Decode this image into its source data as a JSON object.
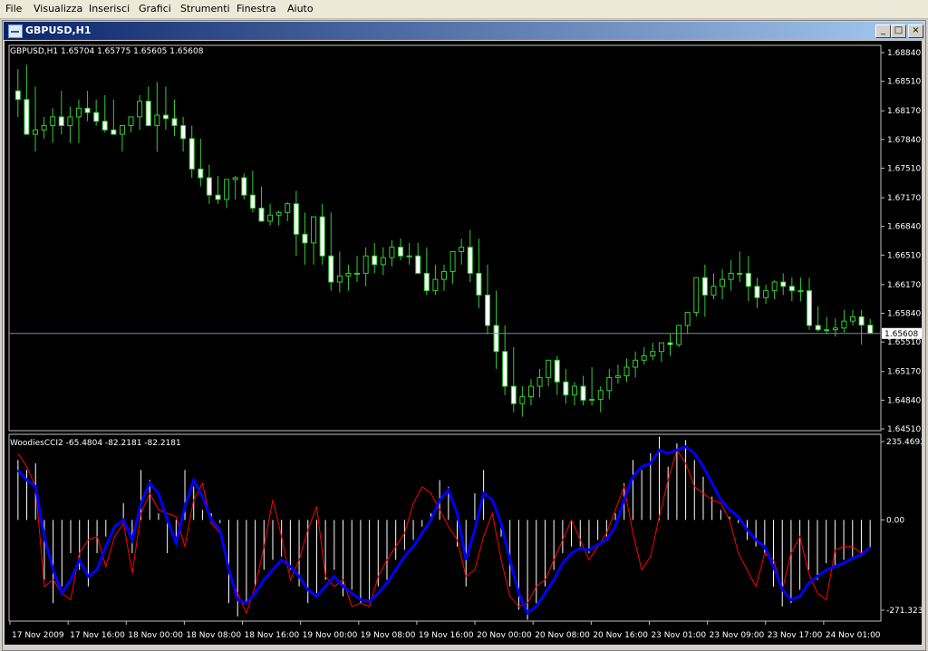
{
  "menu": [
    "File",
    "Visualizza",
    "Inserisci",
    "Grafici",
    "Strumenti",
    "Finestra",
    "Aiuto"
  ],
  "window": {
    "title": "GBPUSD,H1",
    "buttons": [
      "_",
      "□",
      "×"
    ]
  },
  "chart_data": {
    "type": "candlestick",
    "title": "GBPUSD,H1  1.65704 1.65775 1.65605 1.65608",
    "price_axis": [
      "1.68840",
      "1.68510",
      "1.68170",
      "1.67840",
      "1.67510",
      "1.67170",
      "1.66840",
      "1.66510",
      "1.66170",
      "1.65840",
      "1.65510",
      "1.65170",
      "1.64840",
      "1.64510"
    ],
    "current_price": "1.65608",
    "ohlc": {
      "open": [
        1.684,
        1.683,
        1.679,
        1.6795,
        1.68,
        1.681,
        1.68,
        1.681,
        1.682,
        1.6815,
        1.6805,
        1.6795,
        1.679,
        1.68,
        1.681,
        1.6828,
        1.68,
        1.6812,
        1.6808,
        1.68,
        1.6785,
        1.675,
        1.674,
        1.672,
        1.6715,
        1.6738,
        1.674,
        1.672,
        1.6705,
        1.669,
        1.6697,
        1.67,
        1.671,
        1.6675,
        1.6665,
        1.6695,
        1.665,
        1.662,
        1.6627,
        1.663,
        1.663,
        1.665,
        1.664,
        1.6648,
        1.666,
        1.665,
        1.665,
        1.663,
        1.661,
        1.6623,
        1.6632,
        1.6655,
        1.666,
        1.663,
        1.6605,
        1.657,
        1.654,
        1.65,
        1.648,
        1.6488,
        1.65,
        1.651,
        1.653,
        1.6505,
        1.649,
        1.65,
        1.6484,
        1.6485,
        1.6495,
        1.651,
        1.6512,
        1.6522,
        1.653,
        1.6535,
        1.654,
        1.655,
        1.6548,
        1.657,
        1.6585,
        1.6625,
        1.6605,
        1.6615,
        1.6623,
        1.663,
        1.663,
        1.6615,
        1.6602,
        1.661,
        1.662,
        1.6615,
        1.661,
        1.661,
        1.657,
        1.6565,
        1.6565,
        1.6567,
        1.6575,
        1.658,
        1.65704
      ],
      "high": [
        1.6865,
        1.687,
        1.6845,
        1.681,
        1.682,
        1.684,
        1.6822,
        1.683,
        1.684,
        1.683,
        1.6835,
        1.683,
        1.68,
        1.6808,
        1.6835,
        1.6845,
        1.685,
        1.6845,
        1.683,
        1.681,
        1.68,
        1.6785,
        1.6755,
        1.6742,
        1.672,
        1.6742,
        1.6745,
        1.6748,
        1.673,
        1.671,
        1.6702,
        1.6712,
        1.6725,
        1.67,
        1.668,
        1.671,
        1.67,
        1.6655,
        1.664,
        1.665,
        1.666,
        1.6665,
        1.666,
        1.6668,
        1.667,
        1.6665,
        1.6665,
        1.666,
        1.664,
        1.664,
        1.6645,
        1.667,
        1.668,
        1.667,
        1.664,
        1.661,
        1.657,
        1.6545,
        1.65,
        1.6508,
        1.652,
        1.653,
        1.6535,
        1.652,
        1.6505,
        1.6512,
        1.6522,
        1.65,
        1.652,
        1.6525,
        1.6532,
        1.654,
        1.6545,
        1.655,
        1.655,
        1.656,
        1.6565,
        1.6585,
        1.6625,
        1.664,
        1.663,
        1.6635,
        1.6645,
        1.6655,
        1.665,
        1.6625,
        1.6617,
        1.6622,
        1.663,
        1.6625,
        1.6625,
        1.6625,
        1.6592,
        1.658,
        1.6578,
        1.6588,
        1.6588,
        1.6588,
        1.65775
      ],
      "low": [
        1.681,
        1.679,
        1.677,
        1.6785,
        1.678,
        1.679,
        1.678,
        1.678,
        1.6805,
        1.68,
        1.6792,
        1.679,
        1.677,
        1.6792,
        1.6795,
        1.68,
        1.677,
        1.6795,
        1.6788,
        1.677,
        1.674,
        1.673,
        1.671,
        1.671,
        1.6705,
        1.6715,
        1.6715,
        1.67,
        1.669,
        1.6685,
        1.6685,
        1.669,
        1.665,
        1.664,
        1.664,
        1.664,
        1.661,
        1.6608,
        1.661,
        1.662,
        1.6615,
        1.663,
        1.6628,
        1.6638,
        1.6645,
        1.664,
        1.6635,
        1.6605,
        1.6605,
        1.661,
        1.6618,
        1.664,
        1.662,
        1.659,
        1.656,
        1.652,
        1.649,
        1.647,
        1.6465,
        1.6478,
        1.6487,
        1.65,
        1.649,
        1.648,
        1.6478,
        1.6478,
        1.6478,
        1.647,
        1.6485,
        1.6503,
        1.6505,
        1.651,
        1.6525,
        1.653,
        1.6528,
        1.6535,
        1.6545,
        1.656,
        1.658,
        1.658,
        1.66,
        1.66,
        1.661,
        1.662,
        1.6598,
        1.659,
        1.6595,
        1.66,
        1.6605,
        1.6598,
        1.6598,
        1.6565,
        1.6563,
        1.656,
        1.6557,
        1.6562,
        1.657,
        1.6548,
        1.65605
      ],
      "close": [
        1.683,
        1.679,
        1.6795,
        1.68,
        1.681,
        1.68,
        1.681,
        1.682,
        1.6815,
        1.6805,
        1.6795,
        1.679,
        1.68,
        1.681,
        1.6828,
        1.68,
        1.6812,
        1.6808,
        1.68,
        1.6785,
        1.675,
        1.674,
        1.672,
        1.6715,
        1.6738,
        1.674,
        1.672,
        1.6705,
        1.669,
        1.6697,
        1.67,
        1.671,
        1.6675,
        1.6665,
        1.6695,
        1.665,
        1.662,
        1.6627,
        1.663,
        1.663,
        1.665,
        1.664,
        1.6648,
        1.666,
        1.665,
        1.665,
        1.663,
        1.661,
        1.6623,
        1.6632,
        1.6655,
        1.666,
        1.663,
        1.6605,
        1.657,
        1.654,
        1.65,
        1.648,
        1.6488,
        1.65,
        1.651,
        1.653,
        1.6505,
        1.649,
        1.65,
        1.6484,
        1.6485,
        1.6495,
        1.651,
        1.6512,
        1.6522,
        1.653,
        1.6535,
        1.654,
        1.655,
        1.6548,
        1.657,
        1.6585,
        1.6625,
        1.6605,
        1.6615,
        1.6623,
        1.663,
        1.663,
        1.6615,
        1.6602,
        1.661,
        1.662,
        1.6615,
        1.661,
        1.661,
        1.657,
        1.6565,
        1.6565,
        1.6567,
        1.6575,
        1.658,
        1.65704,
        1.65608
      ]
    },
    "time_axis": [
      "17 Nov 2009",
      "17 Nov 16:00",
      "18 Nov 00:00",
      "18 Nov 08:00",
      "18 Nov 16:00",
      "19 Nov 00:00",
      "19 Nov 08:00",
      "19 Nov 16:00",
      "20 Nov 00:00",
      "20 Nov 08:00",
      "20 Nov 16:00",
      "23 Nov 01:00",
      "23 Nov 09:00",
      "23 Nov 17:00",
      "24 Nov 01:00"
    ],
    "indicator": {
      "label": "WoodiesCCI2 -65.4804 -82.2181 -82.2181",
      "axis": [
        "235.4693",
        "0.00",
        "-271.323"
      ],
      "ylim": [
        -271.323,
        235.4693
      ],
      "histogram": [
        180,
        150,
        170,
        -180,
        -250,
        -200,
        -100,
        -150,
        -200,
        -100,
        -50,
        0,
        50,
        -100,
        150,
        120,
        20,
        -100,
        -50,
        150,
        100,
        30,
        20,
        -10,
        -250,
        -290,
        -250,
        -200,
        -150,
        -120,
        -110,
        -150,
        -200,
        -250,
        -220,
        -180,
        -150,
        -230,
        -210,
        -250,
        -240,
        -200,
        -180,
        -120,
        -90,
        -60,
        -20,
        20,
        120,
        100,
        -80,
        -200,
        80,
        150,
        0,
        -50,
        -200,
        -270,
        -300,
        -250,
        -200,
        -150,
        -100,
        -80,
        -80,
        -100,
        -60,
        -50,
        20,
        110,
        180,
        150,
        200,
        250,
        160,
        230,
        240,
        180,
        130,
        70,
        30,
        10,
        -10,
        -60,
        -80,
        -100,
        -200,
        -260,
        -250,
        -210,
        -150,
        -180,
        -130,
        -140,
        -120,
        -110,
        -100,
        -82
      ],
      "cci_fast": [
        180,
        150,
        170,
        -180,
        -250,
        -200,
        -100,
        -150,
        -200,
        -100,
        -50,
        0,
        50,
        -100,
        150,
        120,
        20,
        -100,
        -50,
        150,
        100,
        30,
        20,
        -10,
        -250,
        -290,
        -250,
        -200,
        -150,
        -120,
        -110,
        -150,
        -200,
        -250,
        -220,
        -180,
        -150,
        -230,
        -210,
        -250,
        -240,
        -200,
        -180,
        -120,
        -90,
        -60,
        -20,
        20,
        120,
        100,
        -80,
        -200,
        80,
        150,
        0,
        -50,
        -200,
        -270,
        -300,
        -250,
        -200,
        -150,
        -100,
        -80,
        -80,
        -100,
        -60,
        -50,
        20,
        110,
        180,
        150,
        200,
        250,
        160,
        230,
        240,
        180,
        130,
        70,
        30,
        10,
        -10,
        -60,
        -80,
        -100,
        -200,
        -260,
        -250,
        -210,
        -150,
        -180,
        -130,
        -140,
        -120,
        -110,
        -100,
        -82
      ],
      "cci_slow": [
        150,
        120,
        100,
        -50,
        -150,
        -220,
        -180,
        -120,
        -170,
        -150,
        -80,
        -20,
        0,
        -60,
        50,
        110,
        80,
        0,
        -70,
        40,
        120,
        70,
        0,
        -30,
        -150,
        -240,
        -250,
        -220,
        -180,
        -150,
        -120,
        -140,
        -170,
        -210,
        -230,
        -200,
        -170,
        -200,
        -220,
        -240,
        -245,
        -220,
        -190,
        -150,
        -110,
        -80,
        -40,
        0,
        60,
        90,
        20,
        -120,
        -30,
        80,
        60,
        -10,
        -120,
        -220,
        -280,
        -260,
        -220,
        -180,
        -130,
        -100,
        -85,
        -90,
        -75,
        -60,
        -20,
        60,
        130,
        160,
        170,
        210,
        200,
        210,
        220,
        200,
        160,
        110,
        60,
        30,
        10,
        -30,
        -60,
        -80,
        -140,
        -210,
        -240,
        -230,
        -190,
        -170,
        -150,
        -140,
        -130,
        -115,
        -105,
        -82
      ],
      "signal": [
        200,
        160,
        100,
        -200,
        -180,
        -220,
        -240,
        -100,
        -60,
        -50,
        -140,
        -50,
        -10,
        -160,
        20,
        80,
        30,
        20,
        10,
        -80,
        60,
        110,
        -10,
        -40,
        -160,
        -220,
        -280,
        -200,
        -80,
        60,
        -50,
        -180,
        -120,
        -30,
        40,
        -170,
        -200,
        -180,
        -260,
        -250,
        -260,
        -170,
        -120,
        -80,
        -40,
        50,
        100,
        80,
        30,
        -20,
        -60,
        -170,
        -150,
        -50,
        20,
        -120,
        -230,
        -260,
        -250,
        -200,
        -180,
        -120,
        -60,
        0,
        -60,
        -120,
        -80,
        -40,
        30,
        100,
        -40,
        -150,
        -110,
        10,
        120,
        210,
        170,
        100,
        80,
        60,
        50,
        0,
        -100,
        -150,
        -200,
        -100,
        -120,
        -210,
        -100,
        -50,
        -160,
        -220,
        -240,
        -90,
        -80,
        -80,
        -100,
        -82
      ]
    }
  }
}
